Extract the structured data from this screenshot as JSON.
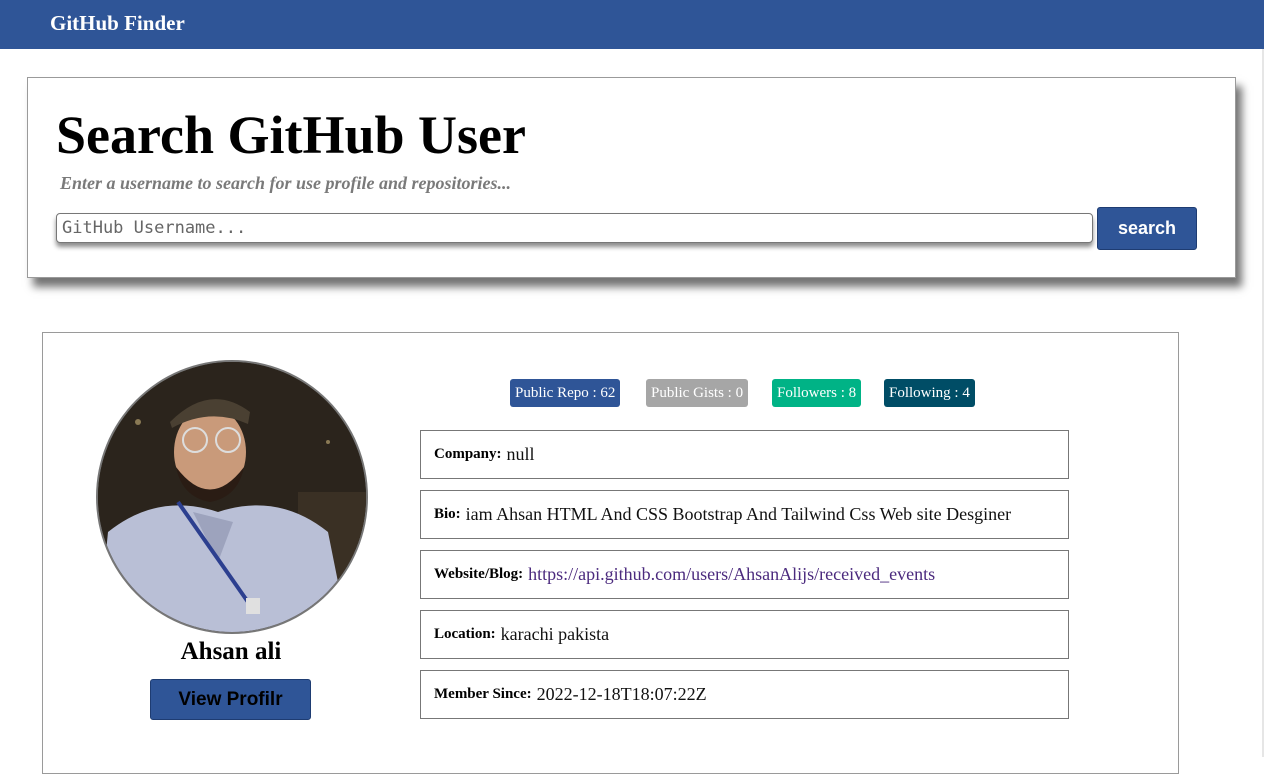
{
  "navbar": {
    "brand": "GitHub Finder"
  },
  "search": {
    "title": "Search GitHub User",
    "subtitle": "Enter a username to search for use profile and repositories...",
    "placeholder": "GitHub Username...",
    "value": "",
    "button_label": "search"
  },
  "profile": {
    "name": "Ahsan ali",
    "view_button_label": "View Profilr",
    "badges": {
      "repos": "Public Repo : 62",
      "gists": "Public Gists : 0",
      "followers": "Followers : 8",
      "following": "Following : 4"
    },
    "fields": {
      "company": {
        "label": "Company:",
        "value": "null"
      },
      "bio": {
        "label": "Bio:",
        "value": "iam Ahsan HTML And CSS Bootstrap And Tailwind Css Web site Desginer"
      },
      "website": {
        "label": "Website/Blog:",
        "value": "https://api.github.com/users/AhsanAlijs/received_events"
      },
      "location": {
        "label": "Location:",
        "value": "karachi pakista"
      },
      "member_since": {
        "label": "Member Since:",
        "value": "2022-12-18T18:07:22Z"
      }
    }
  },
  "colors": {
    "primary": "#2f5597",
    "badge_repos": "#2f5597",
    "badge_gists": "#a6a6a6",
    "badge_followers": "#00b386",
    "badge_following": "#004d66",
    "link": "#4b2a7e"
  }
}
